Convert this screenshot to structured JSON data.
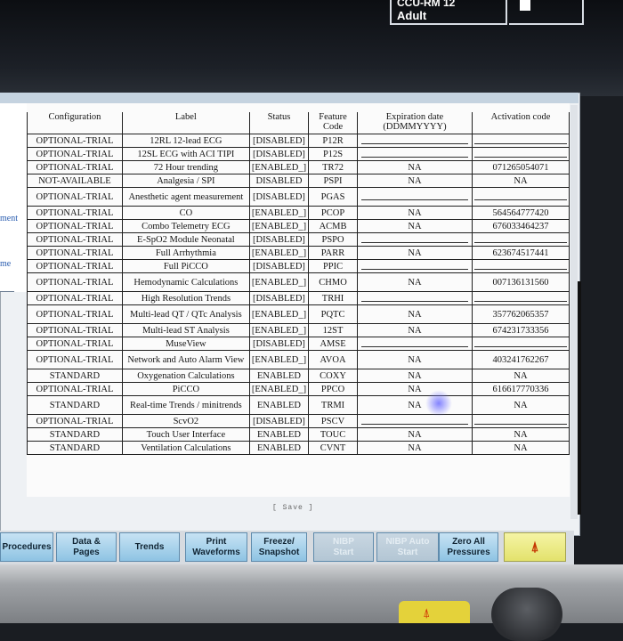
{
  "header": {
    "bed_label_partial": "CCU-RM 12",
    "patient_category": "Adult"
  },
  "side_panel": {
    "label_1": "ment",
    "label_2": "me"
  },
  "table": {
    "columns": [
      "Configuration",
      "Label",
      "Status",
      "Feature Code",
      "Expiration date (DDMMYYYY)",
      "Activation code"
    ],
    "rows": [
      {
        "config": "OPTIONAL-TRIAL",
        "label": "12RL 12-lead ECG",
        "status": "[DISABLED]",
        "code": "P12R",
        "exp": "",
        "act": ""
      },
      {
        "config": "OPTIONAL-TRIAL",
        "label": "12SL ECG with ACI TIPI",
        "status": "[DISABLED]",
        "code": "P12S",
        "exp": "",
        "act": ""
      },
      {
        "config": "OPTIONAL-TRIAL",
        "label": "72 Hour trending",
        "status": "[ENABLED_]",
        "code": "TR72",
        "exp": "NA",
        "act": "071265054071"
      },
      {
        "config": "NOT-AVAILABLE",
        "label": "Analgesia / SPI",
        "status": "DISABLED",
        "code": "PSPI",
        "exp": "NA",
        "act": "NA"
      },
      {
        "config": "OPTIONAL-TRIAL",
        "label": "Anesthetic agent measurement",
        "status": "[DISABLED]",
        "code": "PGAS",
        "exp": "",
        "act": ""
      },
      {
        "config": "OPTIONAL-TRIAL",
        "label": "CO",
        "status": "[ENABLED_]",
        "code": "PCOP",
        "exp": "NA",
        "act": "564564777420"
      },
      {
        "config": "OPTIONAL-TRIAL",
        "label": "Combo Telemetry ECG",
        "status": "[ENABLED_]",
        "code": "ACMB",
        "exp": "NA",
        "act": "676033464237"
      },
      {
        "config": "OPTIONAL-TRIAL",
        "label": "E-SpO2 Module Neonatal",
        "status": "[DISABLED]",
        "code": "PSPO",
        "exp": "",
        "act": ""
      },
      {
        "config": "OPTIONAL-TRIAL",
        "label": "Full Arrhythmia",
        "status": "[ENABLED_]",
        "code": "PARR",
        "exp": "NA",
        "act": "623674517441"
      },
      {
        "config": "OPTIONAL-TRIAL",
        "label": "Full PiCCO",
        "status": "[DISABLED]",
        "code": "PPIC",
        "exp": "",
        "act": ""
      },
      {
        "config": "OPTIONAL-TRIAL",
        "label": "Hemodynamic Calculations",
        "status": "[ENABLED_]",
        "code": "CHMO",
        "exp": "NA",
        "act": "007136131560"
      },
      {
        "config": "OPTIONAL-TRIAL",
        "label": "High Resolution Trends",
        "status": "[DISABLED]",
        "code": "TRHI",
        "exp": "",
        "act": ""
      },
      {
        "config": "OPTIONAL-TRIAL",
        "label": "Multi-lead QT / QTc Analysis",
        "status": "[ENABLED_]",
        "code": "PQTC",
        "exp": "NA",
        "act": "357762065357"
      },
      {
        "config": "OPTIONAL-TRIAL",
        "label": "Multi-lead ST Analysis",
        "status": "[ENABLED_]",
        "code": "12ST",
        "exp": "NA",
        "act": "674231733356"
      },
      {
        "config": "OPTIONAL-TRIAL",
        "label": "MuseView",
        "status": "[DISABLED]",
        "code": "AMSE",
        "exp": "",
        "act": ""
      },
      {
        "config": "OPTIONAL-TRIAL",
        "label": "Network and Auto Alarm View",
        "status": "[ENABLED_]",
        "code": "AVOA",
        "exp": "NA",
        "act": "403241762267"
      },
      {
        "config": "STANDARD",
        "label": "Oxygenation Calculations",
        "status": "ENABLED",
        "code": "COXY",
        "exp": "NA",
        "act": "NA"
      },
      {
        "config": "OPTIONAL-TRIAL",
        "label": "PiCCO",
        "status": "[ENABLED_]",
        "code": "PPCO",
        "exp": "NA",
        "act": "616617770336"
      },
      {
        "config": "STANDARD",
        "label": "Real-time Trends / minitrends",
        "status": "ENABLED",
        "code": "TRMI",
        "exp": "NA",
        "act": "NA"
      },
      {
        "config": "OPTIONAL-TRIAL",
        "label": "ScvO2",
        "status": "[DISABLED]",
        "code": "PSCV",
        "exp": "",
        "act": ""
      },
      {
        "config": "STANDARD",
        "label": "Touch User Interface",
        "status": "ENABLED",
        "code": "TOUC",
        "exp": "NA",
        "act": "NA"
      },
      {
        "config": "STANDARD",
        "label": "Ventilation Calculations",
        "status": "ENABLED",
        "code": "CVNT",
        "exp": "NA",
        "act": "NA"
      }
    ]
  },
  "save_label": "[ Save ]",
  "buttons": [
    {
      "line1": "Procedures",
      "line2": ""
    },
    {
      "line1": "Data &",
      "line2": "Pages"
    },
    {
      "line1": "Trends",
      "line2": ""
    },
    {
      "line1": "Print",
      "line2": "Waveforms"
    },
    {
      "line1": "Freeze/",
      "line2": "Snapshot"
    },
    {
      "line1": "NIBP",
      "line2": "Start"
    },
    {
      "line1": "NIBP Auto",
      "line2": "Start"
    },
    {
      "line1": "Zero All",
      "line2": "Pressures"
    },
    {
      "line1": "⍋",
      "line2": ""
    }
  ],
  "icons": {
    "alarm_silence": "alarm-bell-icon",
    "cursor": "cursor-x-icon"
  },
  "colors": {
    "button_blue": "#8ec3e3",
    "button_yellow": "#e3e26c",
    "side_text": "#2a5db0"
  }
}
